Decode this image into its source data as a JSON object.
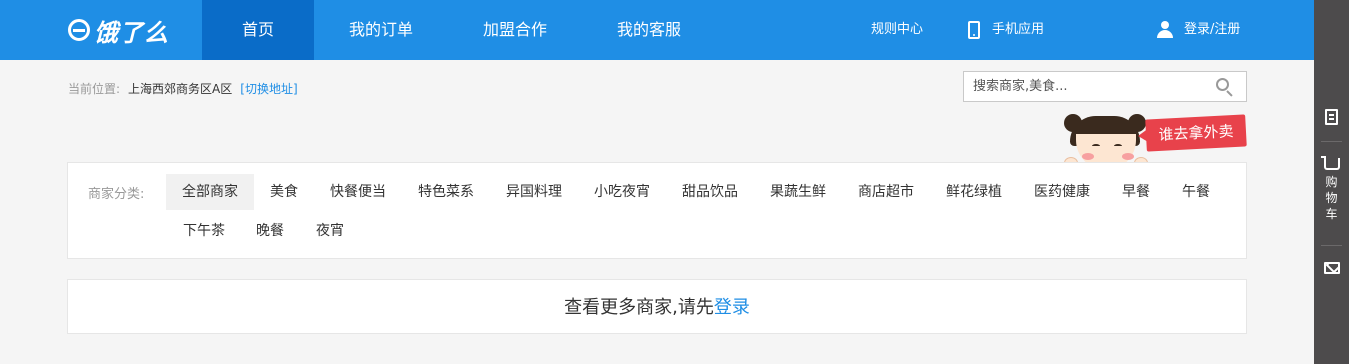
{
  "header": {
    "logo_text": "饿了么",
    "nav": [
      {
        "label": "首页",
        "active": true
      },
      {
        "label": "我的订单",
        "active": false
      },
      {
        "label": "加盟合作",
        "active": false
      },
      {
        "label": "我的客服",
        "active": false
      }
    ],
    "rules_label": "规则中心",
    "mobile_app_label": "手机应用",
    "login_label": "登录/注册",
    "icons": {
      "mobile": "phone-icon",
      "user": "user-icon"
    }
  },
  "location": {
    "prefix": "当前位置:",
    "address": "上海西郊商务区A区",
    "switch_label": "[切换地址]"
  },
  "search": {
    "placeholder": "搜索商家,美食...",
    "value": "",
    "icon": "search-icon"
  },
  "promo": {
    "banner_text": "谁去拿外卖"
  },
  "categories": {
    "label": "商家分类:",
    "items": [
      "全部商家",
      "美食",
      "快餐便当",
      "特色菜系",
      "异国料理",
      "小吃夜宵",
      "甜品饮品",
      "果蔬生鲜",
      "商店超市",
      "鲜花绿植",
      "医药健康",
      "早餐",
      "午餐",
      "下午茶",
      "晚餐",
      "夜宵"
    ],
    "selected": "全部商家"
  },
  "more": {
    "text": "查看更多商家,请先",
    "login_link": "登录"
  },
  "sidebar": {
    "items": [
      {
        "icon": "document-icon",
        "label": ""
      },
      {
        "icon": "cart-icon",
        "label": "购物车"
      },
      {
        "icon": "mail-icon",
        "label": ""
      }
    ]
  },
  "colors": {
    "brand_blue": "#1f8ee5",
    "nav_active": "#0a6cc8",
    "sidebar_bg": "#4d4b4c",
    "promo_red": "#e8424b"
  }
}
